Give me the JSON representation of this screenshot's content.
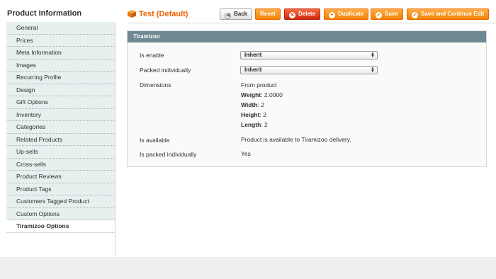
{
  "sidebar": {
    "title": "Product Information",
    "items": [
      {
        "label": "General"
      },
      {
        "label": "Prices"
      },
      {
        "label": "Meta Information"
      },
      {
        "label": "Images"
      },
      {
        "label": "Recurring Profile"
      },
      {
        "label": "Design"
      },
      {
        "label": "Gift Options"
      },
      {
        "label": "Inventory"
      },
      {
        "label": "Categories"
      },
      {
        "label": "Related Products"
      },
      {
        "label": "Up-sells"
      },
      {
        "label": "Cross-sells"
      },
      {
        "label": "Product Reviews"
      },
      {
        "label": "Product Tags"
      },
      {
        "label": "Customers Tagged Product"
      },
      {
        "label": "Custom Options"
      },
      {
        "label": "Tiramizoo Options"
      }
    ],
    "active_item": "Tiramizoo Options"
  },
  "header": {
    "title": "Test (Default)",
    "icon": "product-box-icon",
    "buttons": {
      "back": "Back",
      "reset": "Reset",
      "delete": "Delete",
      "duplicate": "Duplicate",
      "save": "Save",
      "save_continue": "Save and Continue Edit"
    }
  },
  "panel": {
    "title": "Tiramizoo",
    "fields": {
      "is_enable": {
        "label": "Is enable",
        "value": "Inherit"
      },
      "packed_individually": {
        "label": "Packed individually",
        "value": "Inherit"
      },
      "dimensions": {
        "label": "Dimensions",
        "source": "From product",
        "weight": {
          "label": "Weight",
          "value": ": 2.0000"
        },
        "width": {
          "label": "Width",
          "value": ": 2"
        },
        "height": {
          "label": "Height",
          "value": ": 2"
        },
        "length": {
          "label": "Length",
          "value": ": 2"
        }
      },
      "is_available": {
        "label": "Is available",
        "value": "Product is available to Tiramizoo delivery."
      },
      "is_packed_individually": {
        "label": "Is packed individually",
        "value": "Yes"
      }
    }
  },
  "colors": {
    "accent": "#eb5e00",
    "button": "#f18200",
    "panel_header": "#6f8992",
    "sidebar_item": "#e7efef"
  }
}
